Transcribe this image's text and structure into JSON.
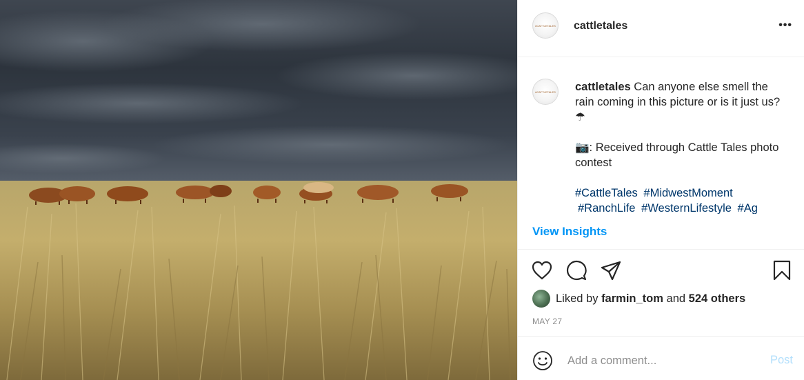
{
  "post": {
    "username": "cattletales",
    "avatar_text": "#CATTLETALES",
    "more_label": "•••"
  },
  "caption": {
    "username": "cattletales",
    "line1": " Can anyone else smell the rain coming in this picture or is it just us? ☂",
    "line2": "📷: Received through Cattle Tales photo contest",
    "hashtags": [
      "#CattleTales",
      "#MidwestMoment",
      "#RanchLife",
      "#WesternLifestyle",
      "#Ag"
    ]
  },
  "insights_label": "View Insights",
  "icons": {
    "like": "heart-icon",
    "comment": "comment-icon",
    "share": "send-icon",
    "save": "bookmark-icon",
    "emoji": "smiley-icon"
  },
  "likes": {
    "prefix": "Liked by ",
    "user": "farmin_tom",
    "middle": " and ",
    "count": "524 others"
  },
  "date": "MAY 27",
  "comment": {
    "placeholder": "Add a comment...",
    "post_label": "Post"
  },
  "colors": {
    "link_blue": "#0095f6",
    "hashtag": "#00376b",
    "post_disabled": "#b2dffc",
    "muted": "#8e8e8e"
  }
}
